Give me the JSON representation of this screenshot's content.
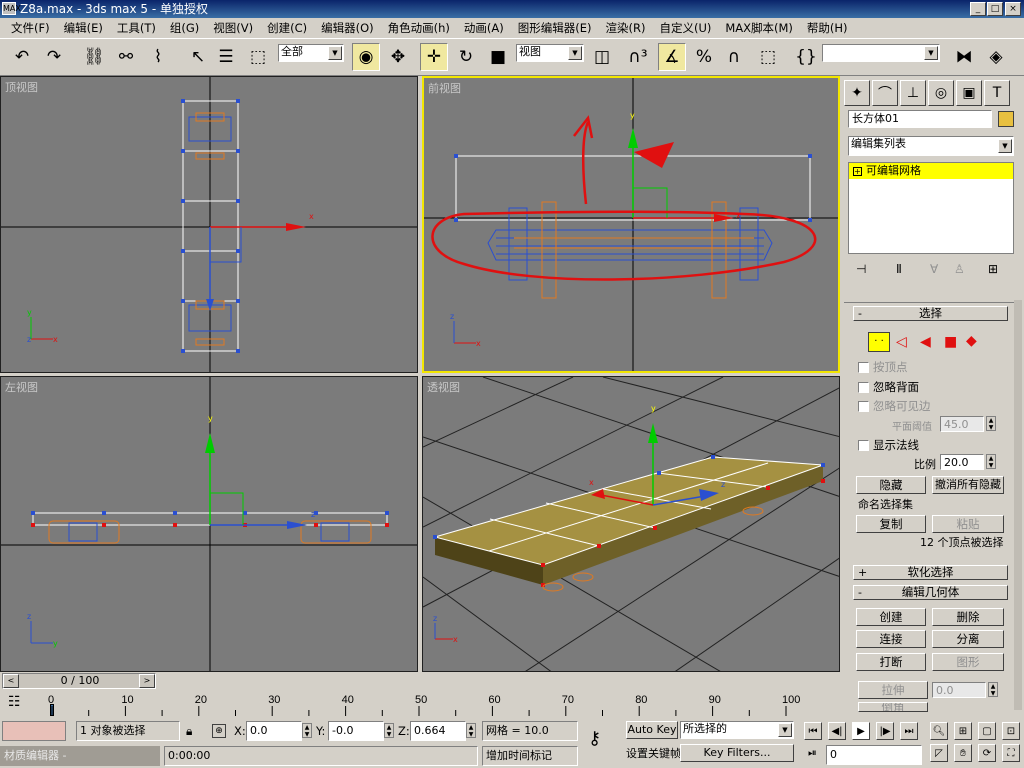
{
  "window": {
    "title": "Z8a.max - 3ds max 5 - 单独授权",
    "icon": "MAX",
    "btn_min": "_",
    "btn_max": "□",
    "btn_close": "×"
  },
  "menu": [
    "文件(F)",
    "编辑(E)",
    "工具(T)",
    "组(G)",
    "视图(V)",
    "创建(C)",
    "编辑器(O)",
    "角色动画(h)",
    "动画(A)",
    "图形编辑器(E)",
    "渲染(R)",
    "自定义(U)",
    "MAX脚本(M)",
    "帮助(H)"
  ],
  "toolbar": {
    "selection_filter": "全部",
    "ref_coord": "视图",
    "named_selection": ""
  },
  "viewports": {
    "top": {
      "label": "顶视图"
    },
    "front": {
      "label": "前视图"
    },
    "left": {
      "label": "左视图"
    },
    "persp": {
      "label": "透视图"
    }
  },
  "command_panel": {
    "object_name": "长方体01",
    "object_color": "#e8c040",
    "modifier_list": "编辑集列表",
    "stack_item": "可编辑网格",
    "rollout_selection": "选择",
    "by_vertex": "按顶点",
    "ignore_backfacing": "忽略背面",
    "ignore_visible_edges": "忽略可见边",
    "planar_threshold_label": "平面阈值",
    "planar_threshold": "45.0",
    "show_normals": "显示法线",
    "scale_label": "比例",
    "scale": "20.0",
    "hide": "隐藏",
    "unhide_all": "撤消所有隐藏",
    "named_sel_sets": "命名选择集",
    "copy": "复制",
    "paste": "粘贴",
    "selection_status": "12 个顶点被选择",
    "rollout_soft": "软化选择",
    "rollout_edit": "编辑几何体",
    "create": "创建",
    "delete": "删除",
    "attach": "连接",
    "detach": "分离",
    "break": "打断",
    "chamfer_label": "图形",
    "extrude": "拉伸",
    "extrude_val": "0.0",
    "bevel": "倒角"
  },
  "timeline": {
    "frame_display": "0 / 100",
    "ticks": [
      "0",
      "10",
      "20",
      "30",
      "40",
      "50",
      "60",
      "70",
      "80",
      "90",
      "100"
    ]
  },
  "status": {
    "selection_info": "1 对象被选择",
    "x_label": "X:",
    "x": "0.0",
    "y_label": "Y:",
    "y": "-0.0",
    "z_label": "Z:",
    "z": "0.664",
    "grid": "网格 = 10.0",
    "auto_key": "Auto Key",
    "key_mode": "所选择的",
    "set_key": "设置关键帧",
    "key_filters": "Key Filters...",
    "add_time_tag": "增加时间标记",
    "time": "0:00:00",
    "material_editor": "材质编辑器 -",
    "current_frame": "0"
  },
  "colors": {
    "viewport_bg": "#7b7b7b",
    "active_border": "#f2e600",
    "highlight": "#ffff00",
    "red_annotation": "#e01010"
  }
}
